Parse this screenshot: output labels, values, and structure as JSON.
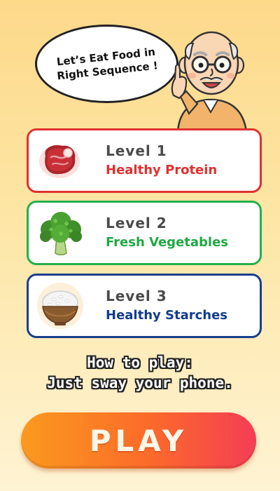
{
  "header": {
    "bubble_line1": "Let’s Eat Food in",
    "bubble_line2": "Right Sequence !"
  },
  "levels": [
    {
      "level": "Level 1",
      "name": "Healthy Protein",
      "icon": "steak-icon",
      "color": "#e0312f"
    },
    {
      "level": "Level 2",
      "name": "Fresh Vegetables",
      "icon": "broccoli-icon",
      "color": "#22b14c"
    },
    {
      "level": "Level 3",
      "name": "Healthy Starches",
      "icon": "rice-bowl-icon",
      "color": "#1a3f8c"
    }
  ],
  "instructions": {
    "line1": "How to play:",
    "line2": "Just sway your phone."
  },
  "play_button": {
    "label": "PLAY"
  },
  "colors": {
    "background_top": "#fdd98a",
    "background_bottom": "#fef3d3",
    "play_gradient_start": "#fb9a1e",
    "play_gradient_end": "#f53d55"
  }
}
